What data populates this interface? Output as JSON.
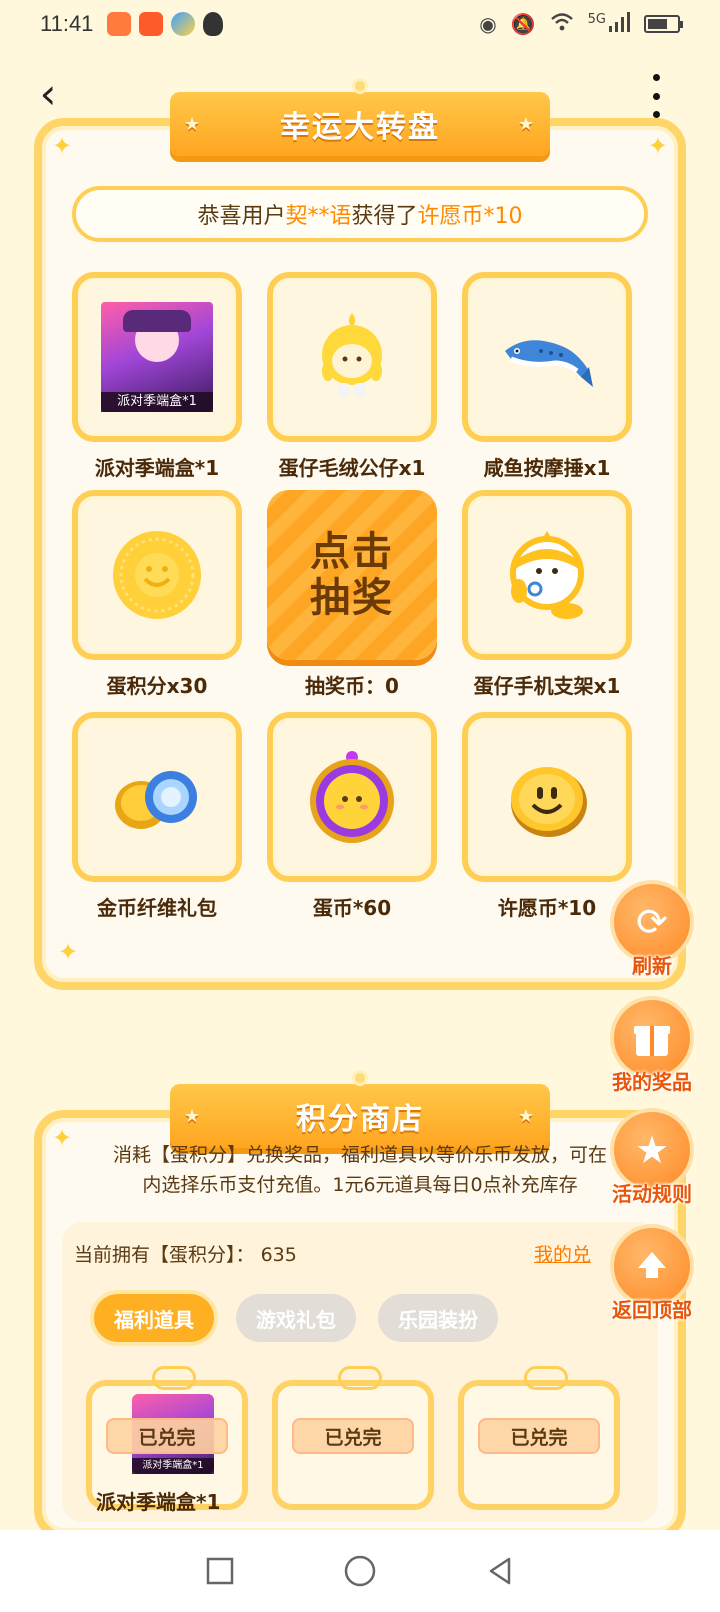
{
  "status_bar": {
    "time": "11:41",
    "network": "5G",
    "badges": [
      "heart-app-badge",
      "party-app-badge",
      "pinwheel-badge",
      "qq-badge"
    ]
  },
  "colors": {
    "accent": "#ffb022",
    "highlight": "#ff8a00",
    "fab_label": "#e8560a",
    "panel_border": "#ffd56a"
  },
  "lottery": {
    "title": "幸运大转盘",
    "marquee": {
      "prefix": "恭喜用户",
      "user": "契**语",
      "middle": "获得了",
      "prize": "许愿币*10"
    },
    "prizes": [
      {
        "label": "派对季端盒*1",
        "icon": "party-box-image",
        "badge": "派对季端盒*1"
      },
      {
        "label": "蛋仔毛绒公仔x1",
        "icon": "eggy-plush-icon"
      },
      {
        "label": "咸鱼按摩捶x1",
        "icon": "salted-fish-hammer-icon"
      },
      {
        "label": "蛋积分x30",
        "icon": "egg-points-coin-icon"
      },
      {
        "label": "抽奖币：0",
        "draw_line1": "点击",
        "draw_line2": "抽奖"
      },
      {
        "label": "蛋仔手机支架x1",
        "icon": "eggy-phone-stand-icon"
      },
      {
        "label": "金币纤维礼包",
        "icon": "gold-coin-fiber-pack-icon"
      },
      {
        "label": "蛋币*60",
        "icon": "egg-coin-icon"
      },
      {
        "label": "许愿币*10",
        "icon": "wish-coin-icon"
      }
    ]
  },
  "side_buttons": [
    {
      "label": "刷新",
      "icon": "refresh-icon"
    },
    {
      "label": "我的奖品",
      "icon": "gift-icon"
    },
    {
      "label": "活动规则",
      "icon": "star-rules-icon"
    },
    {
      "label": "返回顶部",
      "icon": "back-to-top-icon"
    }
  ],
  "shop": {
    "title": "积分商店",
    "desc_line1": "消耗【蛋积分】兑换奖品，福利道具以等价乐币发放，可在",
    "desc_line2": "内选择乐币支付充值。1元6元道具每日0点补充库存",
    "balance_label": "当前拥有【蛋积分】：",
    "balance_value": "635",
    "my_link": "我的兑",
    "tabs": [
      "福利道具",
      "游戏礼包",
      "乐园装扮"
    ],
    "active_tab": 0,
    "goods": [
      {
        "status": "已兑完",
        "thumb_caption": "派对季端盒*1"
      },
      {
        "status": "已兑完"
      },
      {
        "status": "已兑完"
      }
    ],
    "goods_label_partial": "派对季端盒*1"
  }
}
